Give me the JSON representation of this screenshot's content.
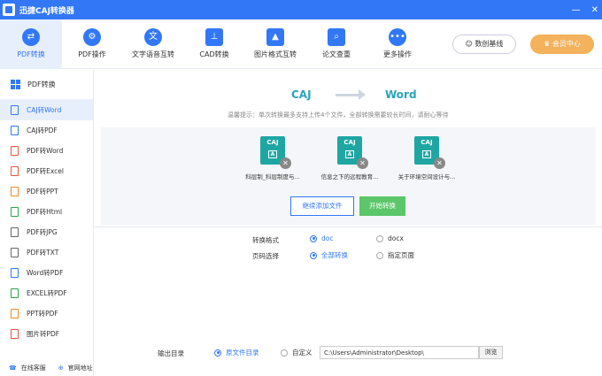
{
  "app": {
    "title": "迅捷CAJ转换器"
  },
  "window": {
    "minimize": "—",
    "close": "✕"
  },
  "toolbar": {
    "tools": [
      {
        "label": "PDF转换",
        "icon": "swap-icon"
      },
      {
        "label": "PDF操作",
        "icon": "gear-icon"
      },
      {
        "label": "文字语音互转",
        "icon": "text-voice-icon"
      },
      {
        "label": "CAD转换",
        "icon": "cad-icon"
      },
      {
        "label": "图片格式互转",
        "icon": "image-icon"
      },
      {
        "label": "论文查重",
        "icon": "search-doc-icon"
      },
      {
        "label": "更多操作",
        "icon": "more-icon"
      }
    ],
    "account_label": "数创基线",
    "vip_label": "会员中心"
  },
  "sidebar": {
    "header": "PDF转换",
    "items": [
      {
        "label": "CAJ转Word"
      },
      {
        "label": "CAJ转PDF"
      },
      {
        "label": "PDF转Word"
      },
      {
        "label": "PDF转Excel"
      },
      {
        "label": "PDF转PPT"
      },
      {
        "label": "PDF转Html"
      },
      {
        "label": "PDF转JPG"
      },
      {
        "label": "PDF转TXT"
      },
      {
        "label": "Word转PDF"
      },
      {
        "label": "EXCEL转PDF"
      },
      {
        "label": "PPT转PDF"
      },
      {
        "label": "图片转PDF"
      }
    ],
    "footer_service": "在线客服",
    "footer_site": "官网地址"
  },
  "main": {
    "from_format": "CAJ",
    "to_format": "Word",
    "tip": "温馨提示：单次转换最多支持上传4个文件，全部转换需要较长时间，请耐心等待",
    "files": [
      {
        "name": "科层制_科层制度与...",
        "badge": "CAJ"
      },
      {
        "name": "信息之下的远程教育...",
        "badge": "CAJ"
      },
      {
        "name": "关于环境空间设计与...",
        "badge": "CAJ"
      }
    ],
    "add_button": "继续添加文件",
    "start_button": "开始转换",
    "format_label": "转换格式",
    "format_options": [
      "doc",
      "docx"
    ],
    "format_selected": "doc",
    "page_label": "页码选择",
    "page_options": [
      "全部转换",
      "指定页面"
    ],
    "page_selected": "全部转换",
    "output_label": "输出目录",
    "output_options": [
      "原文件目录",
      "自定义"
    ],
    "output_selected": "原文件目录",
    "output_path": "C:\\Users\\Administrator\\Desktop\\",
    "browse_button": "浏览"
  }
}
